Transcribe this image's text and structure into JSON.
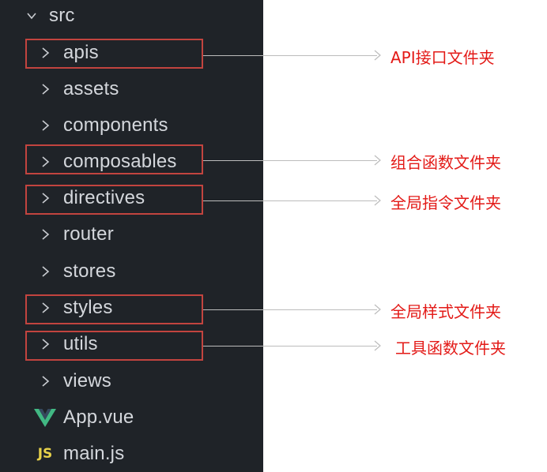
{
  "explorer": {
    "root": {
      "label": "src",
      "icon": "chevron-down-icon"
    },
    "items": [
      {
        "label": "apis",
        "type": "folder",
        "icon": "chevron-right-icon"
      },
      {
        "label": "assets",
        "type": "folder",
        "icon": "chevron-right-icon"
      },
      {
        "label": "components",
        "type": "folder",
        "icon": "chevron-right-icon"
      },
      {
        "label": "composables",
        "type": "folder",
        "icon": "chevron-right-icon"
      },
      {
        "label": "directives",
        "type": "folder",
        "icon": "chevron-right-icon"
      },
      {
        "label": "router",
        "type": "folder",
        "icon": "chevron-right-icon"
      },
      {
        "label": "stores",
        "type": "folder",
        "icon": "chevron-right-icon"
      },
      {
        "label": "styles",
        "type": "folder",
        "icon": "chevron-right-icon"
      },
      {
        "label": "utils",
        "type": "folder",
        "icon": "chevron-right-icon"
      },
      {
        "label": "views",
        "type": "folder",
        "icon": "chevron-right-icon"
      },
      {
        "label": "App.vue",
        "type": "file",
        "icon": "vue-icon"
      },
      {
        "label": "main.js",
        "type": "file",
        "icon": "js-icon",
        "icon_text": "JS"
      }
    ]
  },
  "annotations": [
    {
      "target": "apis",
      "text": "API接口文件夹"
    },
    {
      "target": "composables",
      "text": "组合函数文件夹"
    },
    {
      "target": "directives",
      "text": "全局指令文件夹"
    },
    {
      "target": "styles",
      "text": "全局样式文件夹"
    },
    {
      "target": "utils",
      "text": "工具函数文件夹"
    }
  ],
  "colors": {
    "sidebar_bg": "#1f2328",
    "text": "#d4d7dc",
    "annotation_box": "#c2443f",
    "annotation_text": "#e31a17",
    "vue_green": "#41b883",
    "js_yellow": "#e7d14a"
  }
}
